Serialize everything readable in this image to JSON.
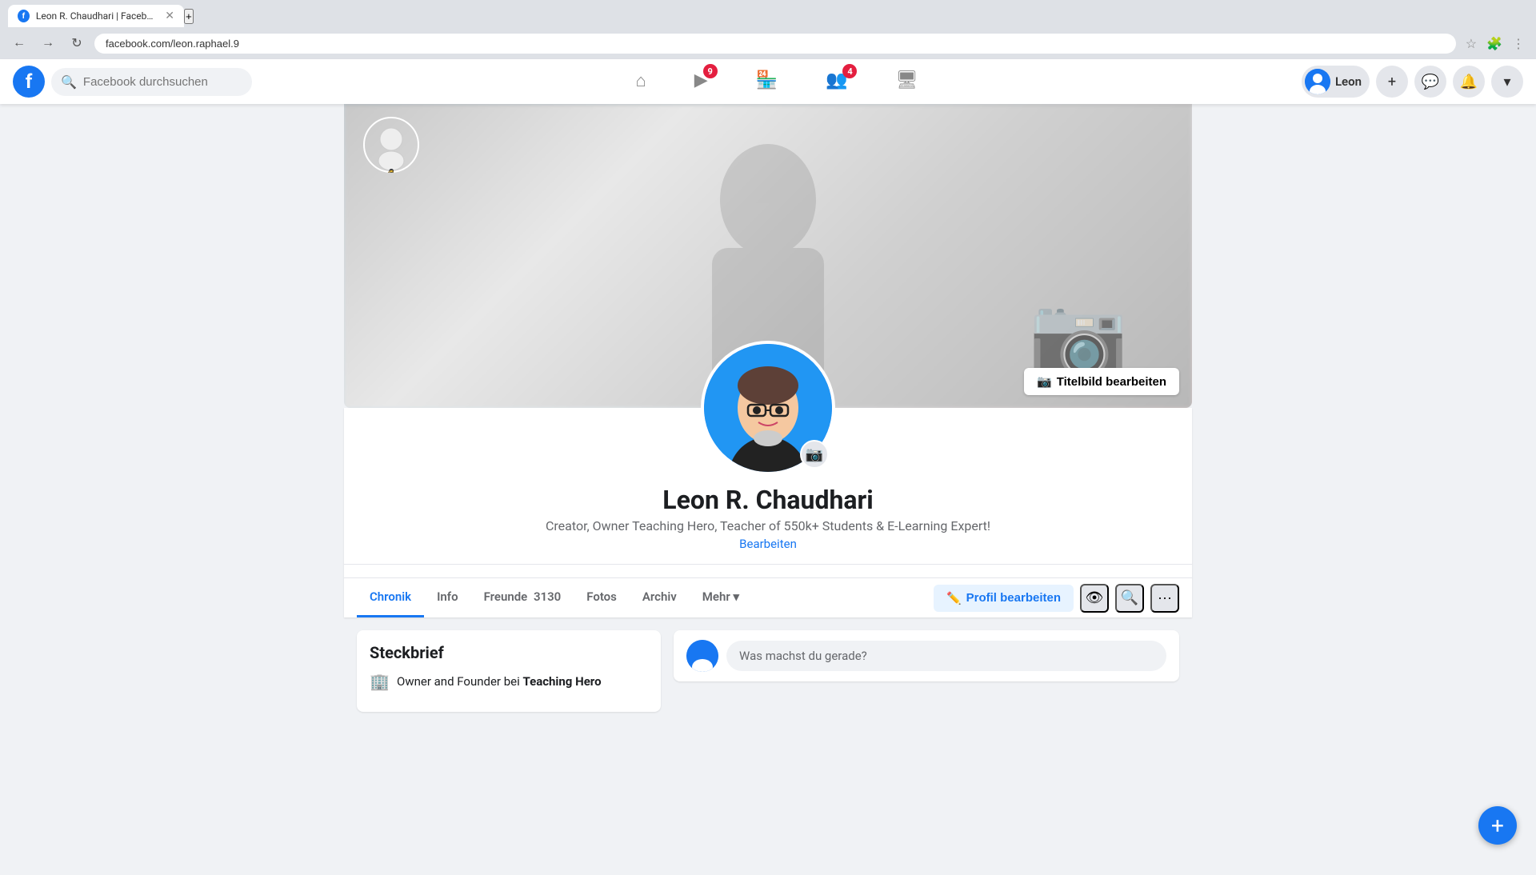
{
  "browser": {
    "tab_title": "Leon R. Chaudhari | Facebook",
    "tab_favicon": "f",
    "tab_new_label": "+",
    "url": "facebook.com/leon.raphael.9",
    "nav_back": "←",
    "nav_forward": "→",
    "nav_refresh": "↻"
  },
  "header": {
    "logo_letter": "f",
    "search_placeholder": "Facebook durchsuchen",
    "nav_items": [
      {
        "id": "home",
        "icon": "⌂",
        "badge": null,
        "active": false
      },
      {
        "id": "video",
        "icon": "▶",
        "badge": "9",
        "active": false
      },
      {
        "id": "marketplace",
        "icon": "🏪",
        "badge": null,
        "active": false
      },
      {
        "id": "groups",
        "icon": "👥",
        "badge": "4",
        "active": false
      },
      {
        "id": "gaming",
        "icon": "🖥",
        "badge": null,
        "active": false
      }
    ],
    "user_name": "Leon",
    "add_btn": "+",
    "messenger_icon": "💬",
    "notifications_icon": "🔔",
    "menu_icon": "▾"
  },
  "profile": {
    "cover_photo_edit_label": "Titelbild bearbeiten",
    "cover_photo_icon": "📷",
    "name": "Leon R. Chaudhari",
    "bio": "Creator, Owner Teaching Hero, Teacher of 550k+ Students & E-Learning Expert!",
    "edit_link": "Bearbeiten",
    "tabs": [
      {
        "id": "chronik",
        "label": "Chronik",
        "active": true
      },
      {
        "id": "info",
        "label": "Info",
        "active": false
      },
      {
        "id": "freunde",
        "label": "Freunde",
        "count": "3130",
        "active": false
      },
      {
        "id": "fotos",
        "label": "Fotos",
        "active": false
      },
      {
        "id": "archiv",
        "label": "Archiv",
        "active": false
      },
      {
        "id": "mehr",
        "label": "Mehr",
        "active": false
      }
    ],
    "action_buttons": {
      "edit_profile": "Profil bearbeiten",
      "edit_profile_icon": "✏️"
    },
    "steckbrief": {
      "title": "Steckbrief",
      "items": [
        {
          "icon": "🏢",
          "text": "Owner and Founder bei ",
          "bold_text": "Teaching Hero"
        }
      ]
    },
    "composer": {
      "placeholder": "Was machst du gerade?"
    }
  },
  "colors": {
    "primary": "#1877f2",
    "danger": "#e41e3f",
    "bg": "#f0f2f5",
    "card_bg": "#ffffff",
    "text_primary": "#1c1e21",
    "text_secondary": "#65676b"
  }
}
